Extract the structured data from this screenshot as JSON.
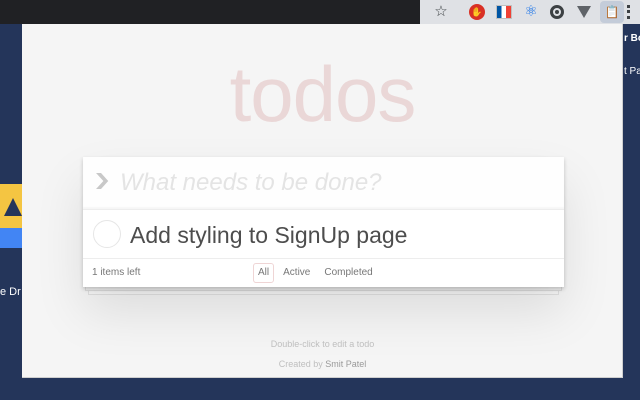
{
  "browser": {
    "extensions": [
      {
        "name": "star-icon",
        "glyph": "☆"
      },
      {
        "name": "adblock-icon",
        "glyph": "✋"
      },
      {
        "name": "flag-icon",
        "glyph": ""
      },
      {
        "name": "react-devtools-icon",
        "glyph": "⚛"
      },
      {
        "name": "target-icon",
        "glyph": ""
      },
      {
        "name": "vue-devtools-icon",
        "glyph": ""
      },
      {
        "name": "todo-extension-icon",
        "glyph": "📋"
      },
      {
        "name": "more-menu-icon",
        "glyph": ""
      }
    ]
  },
  "background_page": {
    "left_text": "e Dr",
    "right_text_1": "r Bo",
    "right_text_2": "t Pa"
  },
  "app": {
    "title": "todos",
    "new_todo_placeholder": "What needs to be done?",
    "toggle_all_glyph": "❯",
    "todos": [
      {
        "label": "Add styling to SignUp page",
        "completed": false
      }
    ],
    "footer": {
      "count_text": "1 items left",
      "filters": [
        {
          "label": "All",
          "selected": true
        },
        {
          "label": "Active",
          "selected": false
        },
        {
          "label": "Completed",
          "selected": false
        }
      ]
    },
    "info": {
      "edit_hint": "Double-click to edit a todo",
      "created_by_prefix": "Created by",
      "author": "Smit Patel"
    }
  },
  "colors": {
    "page_background": "#24355a",
    "title_color": "rgba(175,47,47,0.15)",
    "selected_filter_border": "rgba(175,47,47,0.2)"
  }
}
